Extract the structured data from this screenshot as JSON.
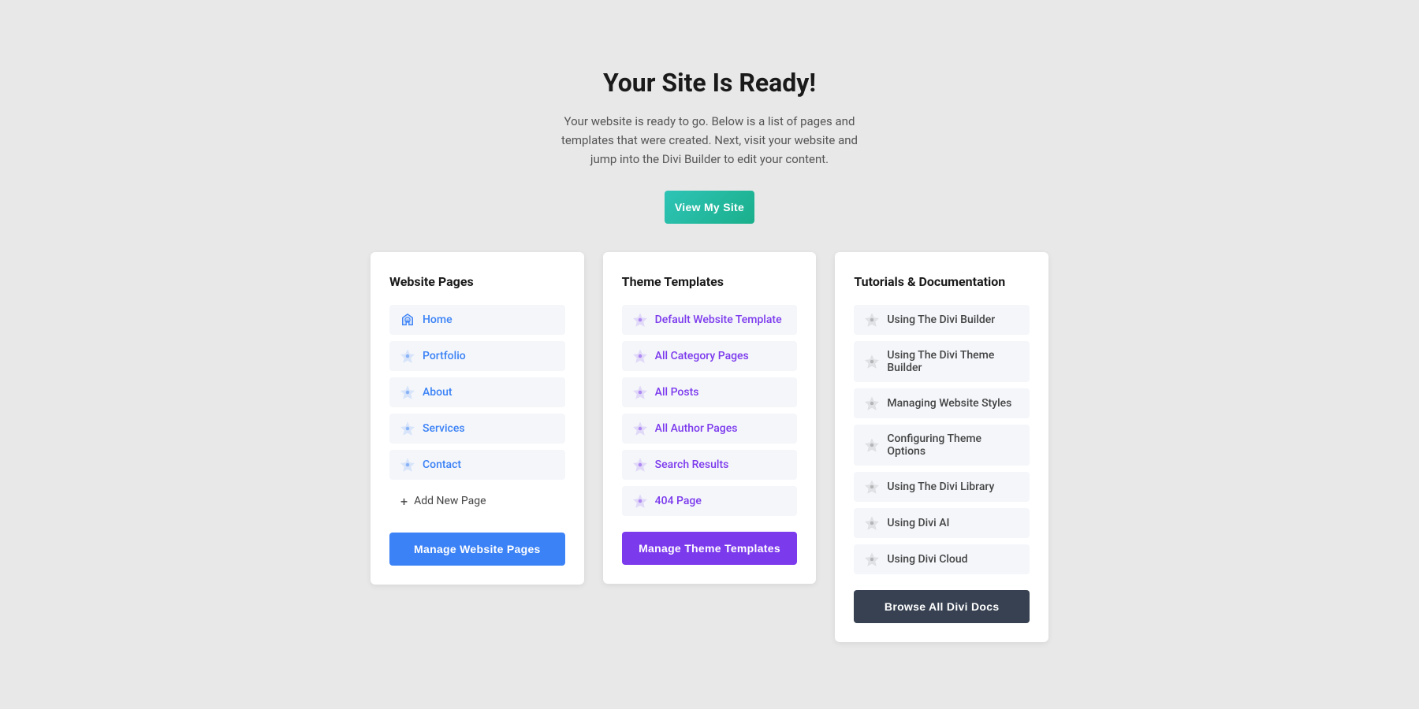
{
  "hero": {
    "title": "Your Site Is Ready!",
    "subtitle": "Your website is ready to go. Below is a list of pages and templates that were created. Next, visit your website and jump into the Divi Builder to edit your content.",
    "view_site_btn": "View My Site"
  },
  "website_pages_card": {
    "title": "Website Pages",
    "items": [
      {
        "label": "Home"
      },
      {
        "label": "Portfolio"
      },
      {
        "label": "About"
      },
      {
        "label": "Services"
      },
      {
        "label": "Contact"
      }
    ],
    "add_new": "+ Add New Page",
    "manage_btn": "Manage Website Pages"
  },
  "theme_templates_card": {
    "title": "Theme Templates",
    "items": [
      {
        "label": "Default Website Template"
      },
      {
        "label": "All Category Pages"
      },
      {
        "label": "All Posts"
      },
      {
        "label": "All Author Pages"
      },
      {
        "label": "Search Results"
      },
      {
        "label": "404 Page"
      }
    ],
    "manage_btn": "Manage Theme Templates"
  },
  "tutorials_card": {
    "title": "Tutorials & Documentation",
    "items": [
      {
        "label": "Using The Divi Builder"
      },
      {
        "label": "Using The Divi Theme Builder"
      },
      {
        "label": "Managing Website Styles"
      },
      {
        "label": "Configuring Theme Options"
      },
      {
        "label": "Using The Divi Library"
      },
      {
        "label": "Using Divi AI"
      },
      {
        "label": "Using Divi Cloud"
      }
    ],
    "browse_btn": "Browse All Divi Docs"
  }
}
